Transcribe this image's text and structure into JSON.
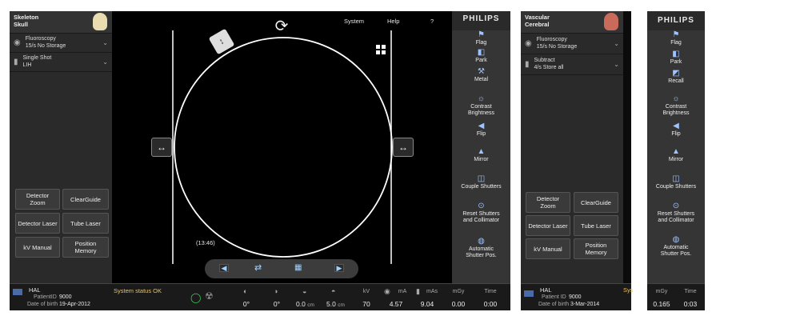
{
  "left_panel": {
    "header": {
      "line1": "Skeleton",
      "line2": "Skull"
    },
    "row1": {
      "line1": "Fluoroscopy",
      "line2": "15/s  No Storage"
    },
    "row2": {
      "line1": "Single Shot",
      "line2": "LIH"
    },
    "buttons": {
      "detector_zoom": "Detector\nZoom",
      "clearguide": "ClearGuide",
      "detector_laser": "Detector Laser",
      "tube_laser": "Tube Laser",
      "kv_manual": "kV Manual",
      "position_memory": "Position\nMemory"
    }
  },
  "top_menu": {
    "system": "System",
    "help": "Help",
    "question": "?"
  },
  "viewer": {
    "timer": "(13:46)"
  },
  "brand": "PHILIPS",
  "right_panel": {
    "items": [
      {
        "label": "Flag",
        "icon": "flag-icon",
        "glyph": "⚑"
      },
      {
        "label": "Park",
        "icon": "park-icon",
        "glyph": "◧"
      },
      {
        "label": "Metal",
        "icon": "metal-icon",
        "glyph": "⚒"
      },
      {
        "label": "Contrast\nBrightness",
        "icon": "contrast-icon",
        "glyph": "☼"
      },
      {
        "label": "Flip",
        "icon": "flip-icon",
        "glyph": "◀"
      },
      {
        "label": "Mirror",
        "icon": "mirror-icon",
        "glyph": "▲"
      },
      {
        "label": "Couple Shutters",
        "icon": "shutters-icon",
        "glyph": "◫"
      },
      {
        "label": "Reset Shutters\nand Collimator",
        "icon": "reset-icon",
        "glyph": "⊙"
      },
      {
        "label": "Automatic\nShutter Pos.",
        "icon": "auto-shutter-icon",
        "glyph": "◍"
      }
    ]
  },
  "status_bar": {
    "patient_name": "HAL",
    "patient_id_label": "PatientID",
    "patient_id": "9000",
    "dob_label": "Date of birth",
    "dob": "19-Apr-2012",
    "system_status": "System status OK",
    "angle1": "0°",
    "angle2": "0°",
    "dist1": "0.0",
    "dist1_unit": "cm",
    "dist2": "5.0",
    "dist2_unit": "cm",
    "kv_label": "kV",
    "kv": "70",
    "ma_label": "mA",
    "ma": "4.57",
    "mas_label": "mAs",
    "mas": "9.04",
    "mgy_label": "mGy",
    "mgy": "0.00",
    "time_label": "Time",
    "time": "0:00"
  },
  "panel2": {
    "header": {
      "line1": "Vascular",
      "line2": "Cerebral"
    },
    "row1": {
      "line1": "Fluoroscopy",
      "line2": "15/s  No Storage"
    },
    "row2": {
      "line1": "Subtract",
      "line2": "4/s  Store all"
    },
    "buttons": {
      "detector_zoom": "Detector\nZoom",
      "clearguide": "ClearGuide",
      "detector_laser": "Detector Laser",
      "tube_laser": "Tube Laser",
      "kv_manual": "kV Manual",
      "position_memory": "Position\nMemory"
    },
    "patient_name": "HAL",
    "patient_id_label": "Patient ID",
    "patient_id": "9000",
    "dob_label": "Date of birth",
    "dob": "3-Mar-2014",
    "sys_fragment": "Sys"
  },
  "panel3": {
    "brand": "PHILIPS",
    "items": [
      {
        "label": "Flag",
        "icon": "flag-icon",
        "glyph": "⚑"
      },
      {
        "label": "Park",
        "icon": "park-icon",
        "glyph": "◧"
      },
      {
        "label": "Recall",
        "icon": "recall-icon",
        "glyph": "◩"
      },
      {
        "label": "Contrast\nBrightness",
        "icon": "contrast-icon",
        "glyph": "☼"
      },
      {
        "label": "Flip",
        "icon": "flip-icon",
        "glyph": "◀"
      },
      {
        "label": "Mirror",
        "icon": "mirror-icon",
        "glyph": "▲"
      },
      {
        "label": "Couple Shutters",
        "icon": "shutters-icon",
        "glyph": "◫"
      },
      {
        "label": "Reset Shutters\nand Collimator",
        "icon": "reset-icon",
        "glyph": "⊙"
      },
      {
        "label": "Automatic\nShutter Pos.",
        "icon": "auto-shutter-icon",
        "glyph": "◍"
      }
    ],
    "mgy_label": "mGy",
    "mgy": "0.165",
    "time_label": "Time",
    "time": "0:03"
  }
}
